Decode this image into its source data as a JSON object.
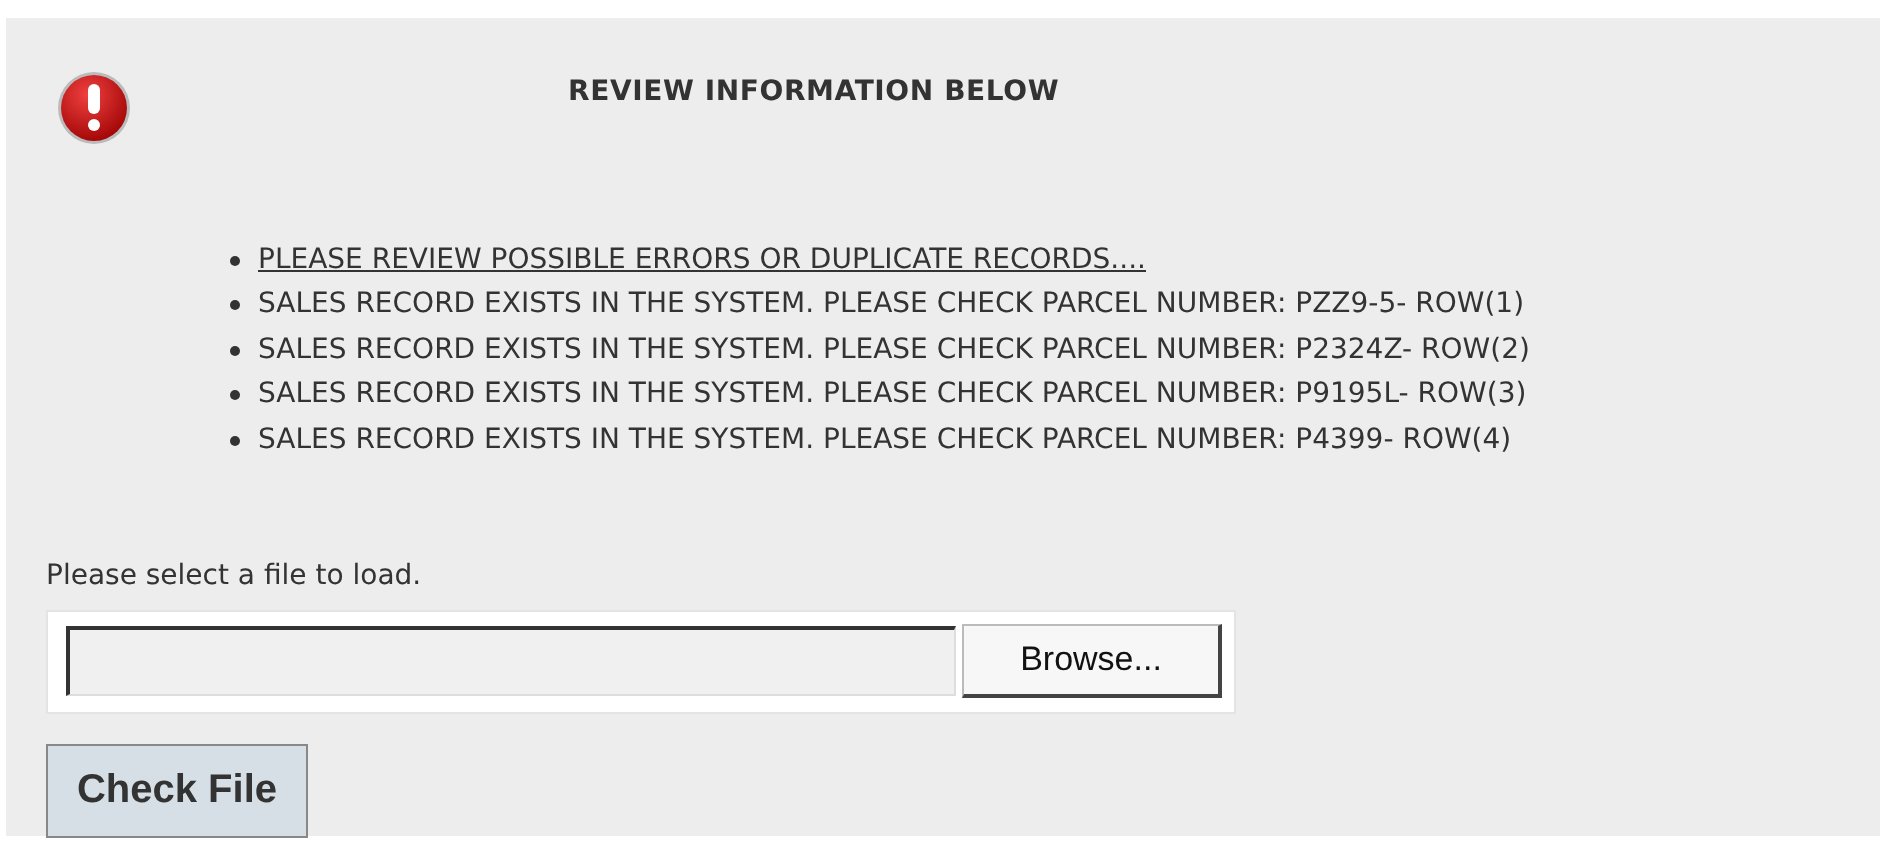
{
  "title": "REVIEW INFORMATION BELOW",
  "messages": [
    {
      "text": "PLEASE REVIEW POSSIBLE ERRORS OR DUPLICATE RECORDS....",
      "kind": "link"
    },
    {
      "text": "SALES RECORD EXISTS IN THE SYSTEM. PLEASE CHECK PARCEL NUMBER: PZZ9-5- ROW(1)",
      "kind": "text"
    },
    {
      "text": "SALES RECORD EXISTS IN THE SYSTEM. PLEASE CHECK PARCEL NUMBER: P2324Z- ROW(2)",
      "kind": "text"
    },
    {
      "text": "SALES RECORD EXISTS IN THE SYSTEM. PLEASE CHECK PARCEL NUMBER: P9195L- ROW(3)",
      "kind": "text"
    },
    {
      "text": "SALES RECORD EXISTS IN THE SYSTEM. PLEASE CHECK PARCEL NUMBER: P4399- ROW(4)",
      "kind": "text"
    }
  ],
  "file_label": "Please select a file to load.",
  "browse_button": "Browse...",
  "check_button": "Check File"
}
